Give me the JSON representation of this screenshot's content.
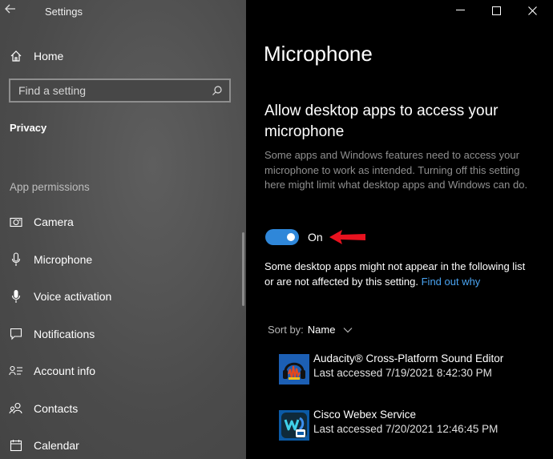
{
  "window": {
    "title": "Settings"
  },
  "sidebar": {
    "home_label": "Home",
    "search_placeholder": "Find a setting",
    "section_title": "Privacy",
    "group_heading": "App permissions",
    "items": [
      {
        "label": "Camera",
        "icon": "camera-icon"
      },
      {
        "label": "Microphone",
        "icon": "microphone-icon"
      },
      {
        "label": "Voice activation",
        "icon": "voice-activation-icon"
      },
      {
        "label": "Notifications",
        "icon": "notifications-icon"
      },
      {
        "label": "Account info",
        "icon": "account-info-icon"
      },
      {
        "label": "Contacts",
        "icon": "contacts-icon"
      },
      {
        "label": "Calendar",
        "icon": "calendar-icon"
      }
    ]
  },
  "main": {
    "page_title": "Microphone",
    "section_heading": "Allow desktop apps to access your microphone",
    "description": "Some apps and Windows features need to access your microphone to work as intended. Turning off this setting here might limit what desktop apps and Windows can do.",
    "toggle": {
      "state": "On",
      "on": true
    },
    "note_text": "Some desktop apps might not appear in the following list or are not affected by this setting. ",
    "note_link": "Find out why",
    "sort_label": "Sort by:",
    "sort_value": "Name",
    "apps": [
      {
        "name": "Audacity® Cross-Platform Sound Editor",
        "last_accessed": "Last accessed 7/19/2021 8:42:30 PM",
        "icon": "audacity-icon"
      },
      {
        "name": "Cisco Webex Service",
        "last_accessed": "Last accessed 7/20/2021 12:46:45 PM",
        "icon": "webex-icon"
      }
    ]
  },
  "colors": {
    "accent": "#2f87d9",
    "link": "#4aa3f0",
    "annotation_arrow": "#e8121f"
  }
}
